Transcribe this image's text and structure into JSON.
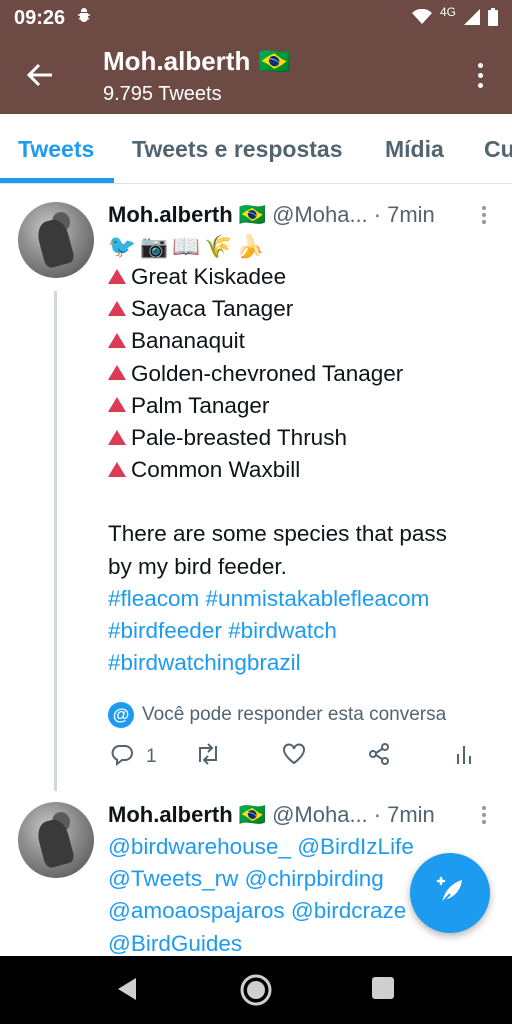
{
  "status_bar": {
    "time": "09:26",
    "network": "4G",
    "icons": [
      "android-debug-icon",
      "wifi-icon",
      "signal-icon",
      "battery-icon"
    ]
  },
  "profile_header": {
    "name": "Moh.alberth",
    "flag": "🇧🇷",
    "tweet_count": "9.795 Tweets"
  },
  "tabs": [
    {
      "label": "Tweets",
      "active": true
    },
    {
      "label": "Tweets e respostas",
      "active": false
    },
    {
      "label": "Mídia",
      "active": false
    },
    {
      "label": "Cu",
      "active": false
    }
  ],
  "tweets": [
    {
      "name": "Moh.alberth",
      "flag": "🇧🇷",
      "handle": "@Moha...",
      "separator": "·",
      "time": "7min",
      "emojis": [
        "🐦",
        "📷",
        "📖",
        "🌾",
        "🍌"
      ],
      "birds": [
        "Great Kiskadee",
        "Sayaca Tanager",
        "Bananaquit",
        "Golden-chevroned Tanager",
        "Palm Tanager",
        "Pale-breasted Thrush",
        "Common Waxbill"
      ],
      "text_line1": "There are some species that pass",
      "text_line2": "by my bird feeder.",
      "hashtags_line1": "#fleacom #unmistakablefleacom",
      "hashtags_line2": "#birdfeeder #birdwatch",
      "hashtags_line3": "#birdwatchingbrazil",
      "reply_notice_symbol": "@",
      "reply_notice": "Você pode responder esta conversa",
      "reply_count": "1"
    },
    {
      "name": "Moh.alberth",
      "flag": "🇧🇷",
      "handle": "@Moha...",
      "separator": "·",
      "time": "7min",
      "mentions_line1": "@birdwarehouse_ @BirdIzLife",
      "mentions_line2": "@Tweets_rw @chirpbirding",
      "mentions_line3": "@amoaospajaros @birdcraze",
      "mentions_line4": "@BirdGuides"
    }
  ],
  "colors": {
    "app_bar": "#6e4a44",
    "accent": "#1d9bf0",
    "triangle": "#dd3b55",
    "muted": "#536471"
  }
}
